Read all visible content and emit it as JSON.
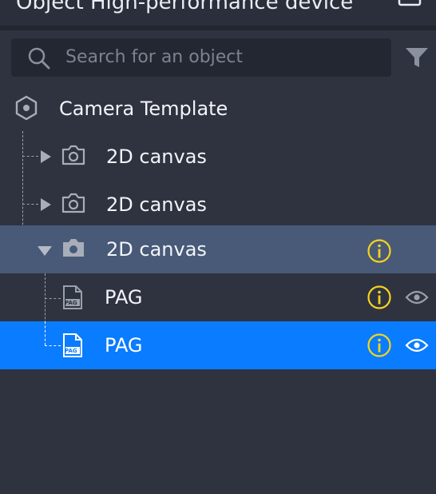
{
  "header": {
    "title": "Object High-performance device"
  },
  "search": {
    "placeholder": "Search for an object"
  },
  "tree": {
    "root": {
      "label": "Camera Template"
    },
    "items": [
      {
        "label": "2D canvas"
      },
      {
        "label": "2D canvas"
      },
      {
        "label": "2D canvas"
      },
      {
        "label": "PAG"
      },
      {
        "label": "PAG"
      }
    ],
    "file_badge": "PAG"
  },
  "colors": {
    "panel_bg": "#2f3340",
    "search_bg": "#232732",
    "selected_parent_bg": "#485a77",
    "selected_bg": "#0a7cff",
    "warning": "#f5d31c"
  }
}
